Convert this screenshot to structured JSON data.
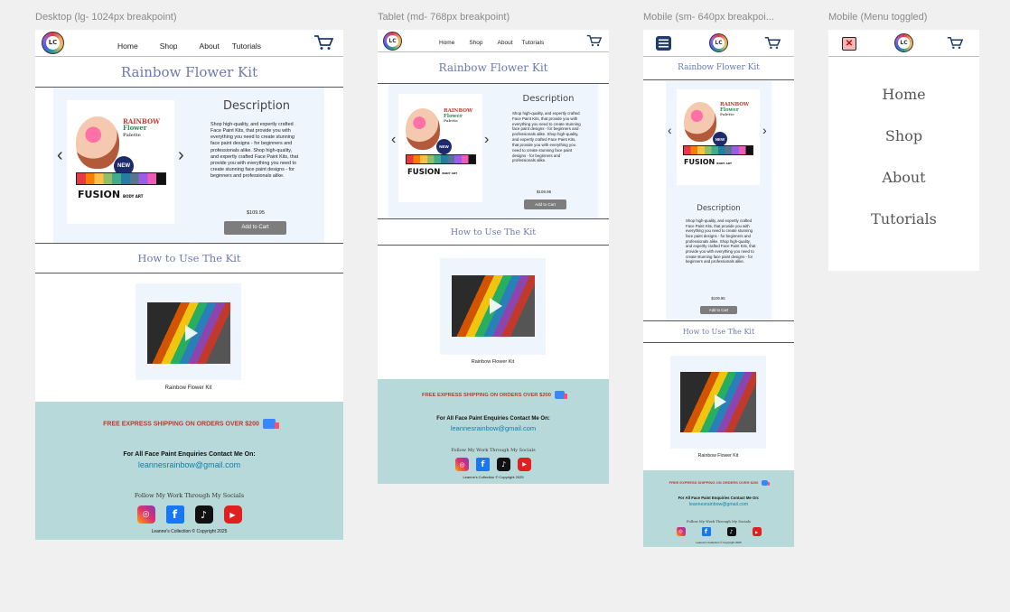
{
  "frames": {
    "desktop": "Desktop (lg- 1024px breakpoint)",
    "tablet": "Tablet (md- 768px breakpoint)",
    "mobile": "Mobile (sm- 640px breakpoi...",
    "menu": "Mobile (Menu toggled)"
  },
  "nav": {
    "logo": "LC",
    "home": "Home",
    "shop": "Shop",
    "about": "About",
    "tutorials": "Tutorials"
  },
  "product": {
    "title": "Rainbow Flower Kit",
    "desc_title": "Description",
    "desc_text": "Shop high-quality, and expertly crafted Face Paint Kits, that provide you with everything you need to create stunning face paint designs - for beginners and professionals alike. Shop high-quality, and expertly crafted Face Paint Kits, that provide you with everything you need to create stunning face paint designs - for beginners and professionals alike.",
    "price": "$109.95",
    "cta": "Add to Cart",
    "badge": "NEW",
    "brand": "FUSION",
    "brand_mark": "BODY ART",
    "kit_name_1": "RAINBOW",
    "kit_name_2": "Flower",
    "kit_name_3": "Palette"
  },
  "howto": {
    "title": "How to Use The Kit",
    "caption": "Rainbow Flower Kit"
  },
  "footer": {
    "shipping": "FREE EXPRESS SHIPPING ON ORDERS OVER $200",
    "enquiries": "For All Face Paint Enquiries Contact Me On:",
    "email": "leannesrainbow@gmail.com",
    "follow": "Follow My Work Through My Socials",
    "copyright": "Leanne's Collection © Copyright 2025"
  },
  "icons": {
    "instagram": "instagram-icon",
    "facebook": "facebook-icon",
    "tiktok": "tiktok-icon",
    "youtube": "youtube-icon",
    "cart": "cart-icon",
    "menu": "hamburger-menu-icon",
    "close": "close-icon"
  }
}
